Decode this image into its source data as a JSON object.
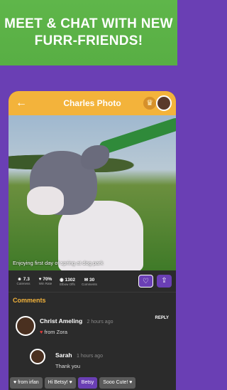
{
  "promo": {
    "line1": "MEET & CHAT WITH NEW",
    "line2": "FURR-FRIENDS!"
  },
  "appbar": {
    "title": "Charles Photo",
    "back_icon": "←",
    "crown_icon": "♛"
  },
  "photo": {
    "caption": "Enjoying first day of spring at dog park"
  },
  "stats": [
    {
      "icon": "☻",
      "value": "7.3",
      "label": "Cuteness"
    },
    {
      "icon": "♥",
      "value": "70%",
      "label": "Win Rate"
    },
    {
      "icon": "◉",
      "value": "1302",
      "label": "Elbow Offs"
    },
    {
      "icon": "✉",
      "value": "30",
      "label": "Comments"
    }
  ],
  "actions": {
    "like_icon": "♡",
    "share_icon": "⇪"
  },
  "comments": {
    "header": "Comments",
    "items": [
      {
        "name": "Christ Ameling",
        "time": "2 hours ago",
        "text": "from Zora",
        "reply": "REPLY"
      },
      {
        "name": "Sarah",
        "time": "1 hours ago",
        "text": "Thank you"
      }
    ]
  },
  "chips": [
    "♥ from irfan",
    "Hi Betsy! ♥",
    "Betsy",
    "Sooo Cute! ♥"
  ]
}
